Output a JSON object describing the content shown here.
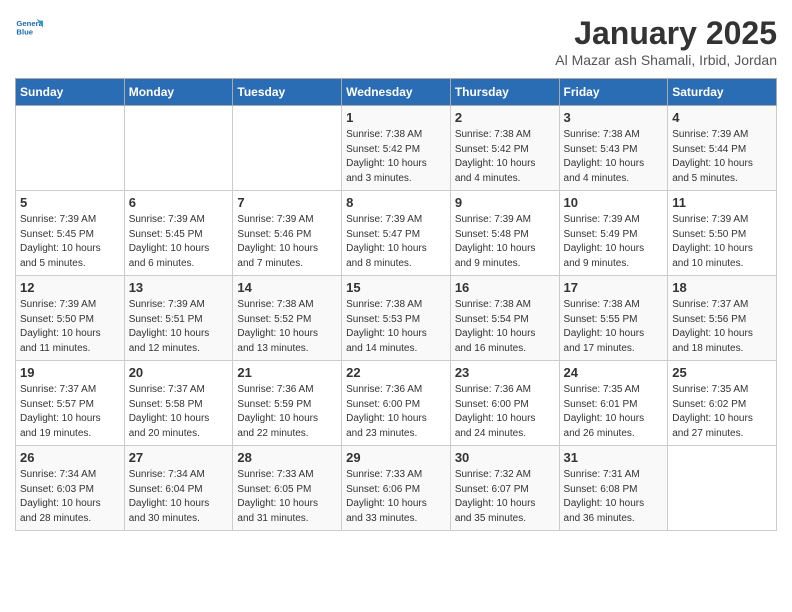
{
  "header": {
    "logo_line1": "General",
    "logo_line2": "Blue",
    "title": "January 2025",
    "subtitle": "Al Mazar ash Shamali, Irbid, Jordan"
  },
  "days_of_week": [
    "Sunday",
    "Monday",
    "Tuesday",
    "Wednesday",
    "Thursday",
    "Friday",
    "Saturday"
  ],
  "weeks": [
    [
      {
        "day": "",
        "info": ""
      },
      {
        "day": "",
        "info": ""
      },
      {
        "day": "",
        "info": ""
      },
      {
        "day": "1",
        "info": "Sunrise: 7:38 AM\nSunset: 5:42 PM\nDaylight: 10 hours and 3 minutes."
      },
      {
        "day": "2",
        "info": "Sunrise: 7:38 AM\nSunset: 5:42 PM\nDaylight: 10 hours and 4 minutes."
      },
      {
        "day": "3",
        "info": "Sunrise: 7:38 AM\nSunset: 5:43 PM\nDaylight: 10 hours and 4 minutes."
      },
      {
        "day": "4",
        "info": "Sunrise: 7:39 AM\nSunset: 5:44 PM\nDaylight: 10 hours and 5 minutes."
      }
    ],
    [
      {
        "day": "5",
        "info": "Sunrise: 7:39 AM\nSunset: 5:45 PM\nDaylight: 10 hours and 5 minutes."
      },
      {
        "day": "6",
        "info": "Sunrise: 7:39 AM\nSunset: 5:45 PM\nDaylight: 10 hours and 6 minutes."
      },
      {
        "day": "7",
        "info": "Sunrise: 7:39 AM\nSunset: 5:46 PM\nDaylight: 10 hours and 7 minutes."
      },
      {
        "day": "8",
        "info": "Sunrise: 7:39 AM\nSunset: 5:47 PM\nDaylight: 10 hours and 8 minutes."
      },
      {
        "day": "9",
        "info": "Sunrise: 7:39 AM\nSunset: 5:48 PM\nDaylight: 10 hours and 9 minutes."
      },
      {
        "day": "10",
        "info": "Sunrise: 7:39 AM\nSunset: 5:49 PM\nDaylight: 10 hours and 9 minutes."
      },
      {
        "day": "11",
        "info": "Sunrise: 7:39 AM\nSunset: 5:50 PM\nDaylight: 10 hours and 10 minutes."
      }
    ],
    [
      {
        "day": "12",
        "info": "Sunrise: 7:39 AM\nSunset: 5:50 PM\nDaylight: 10 hours and 11 minutes."
      },
      {
        "day": "13",
        "info": "Sunrise: 7:39 AM\nSunset: 5:51 PM\nDaylight: 10 hours and 12 minutes."
      },
      {
        "day": "14",
        "info": "Sunrise: 7:38 AM\nSunset: 5:52 PM\nDaylight: 10 hours and 13 minutes."
      },
      {
        "day": "15",
        "info": "Sunrise: 7:38 AM\nSunset: 5:53 PM\nDaylight: 10 hours and 14 minutes."
      },
      {
        "day": "16",
        "info": "Sunrise: 7:38 AM\nSunset: 5:54 PM\nDaylight: 10 hours and 16 minutes."
      },
      {
        "day": "17",
        "info": "Sunrise: 7:38 AM\nSunset: 5:55 PM\nDaylight: 10 hours and 17 minutes."
      },
      {
        "day": "18",
        "info": "Sunrise: 7:37 AM\nSunset: 5:56 PM\nDaylight: 10 hours and 18 minutes."
      }
    ],
    [
      {
        "day": "19",
        "info": "Sunrise: 7:37 AM\nSunset: 5:57 PM\nDaylight: 10 hours and 19 minutes."
      },
      {
        "day": "20",
        "info": "Sunrise: 7:37 AM\nSunset: 5:58 PM\nDaylight: 10 hours and 20 minutes."
      },
      {
        "day": "21",
        "info": "Sunrise: 7:36 AM\nSunset: 5:59 PM\nDaylight: 10 hours and 22 minutes."
      },
      {
        "day": "22",
        "info": "Sunrise: 7:36 AM\nSunset: 6:00 PM\nDaylight: 10 hours and 23 minutes."
      },
      {
        "day": "23",
        "info": "Sunrise: 7:36 AM\nSunset: 6:00 PM\nDaylight: 10 hours and 24 minutes."
      },
      {
        "day": "24",
        "info": "Sunrise: 7:35 AM\nSunset: 6:01 PM\nDaylight: 10 hours and 26 minutes."
      },
      {
        "day": "25",
        "info": "Sunrise: 7:35 AM\nSunset: 6:02 PM\nDaylight: 10 hours and 27 minutes."
      }
    ],
    [
      {
        "day": "26",
        "info": "Sunrise: 7:34 AM\nSunset: 6:03 PM\nDaylight: 10 hours and 28 minutes."
      },
      {
        "day": "27",
        "info": "Sunrise: 7:34 AM\nSunset: 6:04 PM\nDaylight: 10 hours and 30 minutes."
      },
      {
        "day": "28",
        "info": "Sunrise: 7:33 AM\nSunset: 6:05 PM\nDaylight: 10 hours and 31 minutes."
      },
      {
        "day": "29",
        "info": "Sunrise: 7:33 AM\nSunset: 6:06 PM\nDaylight: 10 hours and 33 minutes."
      },
      {
        "day": "30",
        "info": "Sunrise: 7:32 AM\nSunset: 6:07 PM\nDaylight: 10 hours and 35 minutes."
      },
      {
        "day": "31",
        "info": "Sunrise: 7:31 AM\nSunset: 6:08 PM\nDaylight: 10 hours and 36 minutes."
      },
      {
        "day": "",
        "info": ""
      }
    ]
  ]
}
